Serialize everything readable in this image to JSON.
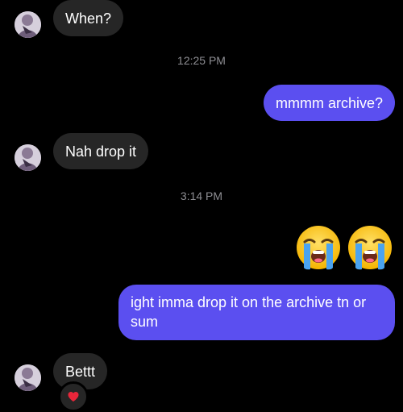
{
  "messages": {
    "m1": {
      "text": "When?"
    },
    "m2": {
      "text": "mmmm archive?"
    },
    "m3": {
      "text": "Nah drop it"
    },
    "m4": {
      "text": "ight imma drop it on the archive tn or sum"
    },
    "m5": {
      "text": "Bettt"
    }
  },
  "timestamps": {
    "t1": "12:25 PM",
    "t2": "3:14 PM"
  },
  "emoji_message": {
    "icons": [
      "loudly-crying-face-icon",
      "loudly-crying-face-icon"
    ]
  },
  "reaction": {
    "icon": "red-heart-icon"
  },
  "colors": {
    "background": "#000000",
    "incoming_bubble": "#262626",
    "outgoing_bubble": "#5b4ff0",
    "timestamp_text": "#8e8e93"
  }
}
